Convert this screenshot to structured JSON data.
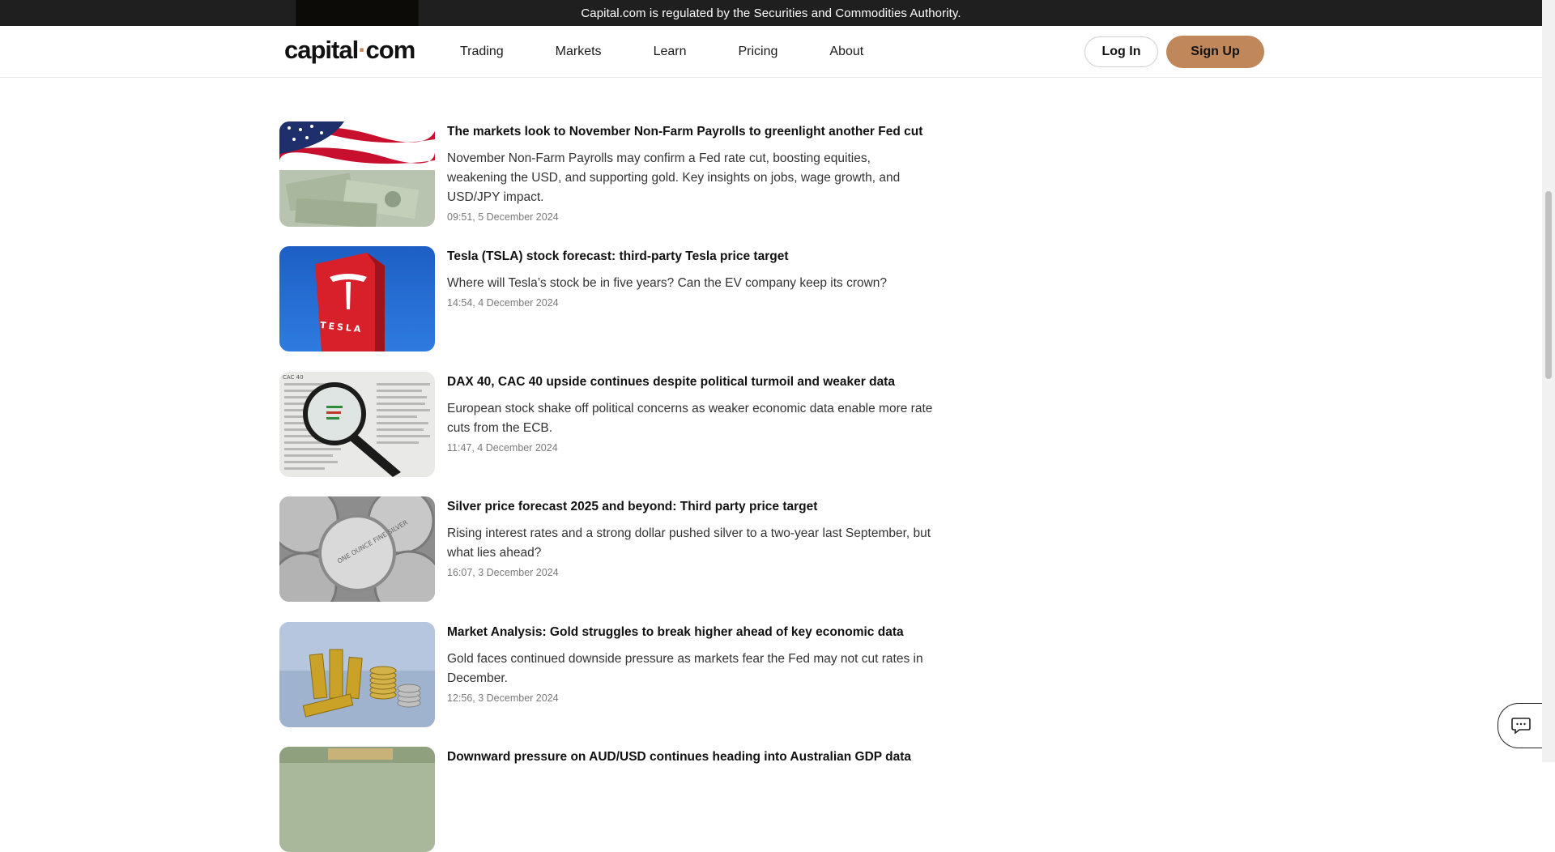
{
  "banner": {
    "text": "Capital.com is regulated by the Securities and Commodities Authority."
  },
  "header": {
    "logo_left": "capital",
    "logo_dot": "·",
    "logo_right": "com",
    "nav": [
      "Trading",
      "Markets",
      "Learn",
      "Pricing",
      "About"
    ],
    "login_label": "Log In",
    "signup_label": "Sign Up"
  },
  "articles": [
    {
      "title": "The markets look to November Non-Farm Payrolls to greenlight another Fed cut",
      "description": "November Non-Farm Payrolls may confirm a Fed rate cut, boosting equities, weakening the USD, and supporting gold. Key insights on jobs, wage growth, and USD/JPY impact.",
      "time": "09:51, 5 December 2024"
    },
    {
      "title": "Tesla (TSLA) stock forecast: third-party Tesla price target",
      "description": "Where will Tesla’s stock be in five years? Can the EV company keep its crown?",
      "time": "14:54, 4 December 2024"
    },
    {
      "title": "DAX 40, CAC 40 upside continues despite political turmoil and weaker data",
      "description": "European stock shake off political concerns as weaker economic data enable more rate cuts from the ECB.",
      "time": "11:47, 4 December 2024"
    },
    {
      "title": "Silver price forecast 2025 and beyond: Third party price target",
      "description": "Rising interest rates and a strong dollar pushed silver to a two-year last September, but what lies ahead?",
      "time": "16:07, 3 December 2024"
    },
    {
      "title": "Market Analysis: Gold struggles to break higher ahead of key economic data",
      "description": "Gold faces continued downside pressure as markets fear the Fed may not cut rates in December.",
      "time": "12:56, 3 December 2024"
    },
    {
      "title": "Downward pressure on AUD/USD continues heading into Australian GDP data",
      "description": "",
      "time": ""
    }
  ],
  "thumbnails": {
    "tesla_sign_text": "TESLA",
    "cac_label": "CAC 40",
    "silver_coin_text": "ONE OUNCE FINE SILVER"
  },
  "colors": {
    "accent": "#c0875a",
    "banner_bg": "#1f1f1f"
  },
  "icons": {
    "chat": "chat-bubble-icon"
  }
}
